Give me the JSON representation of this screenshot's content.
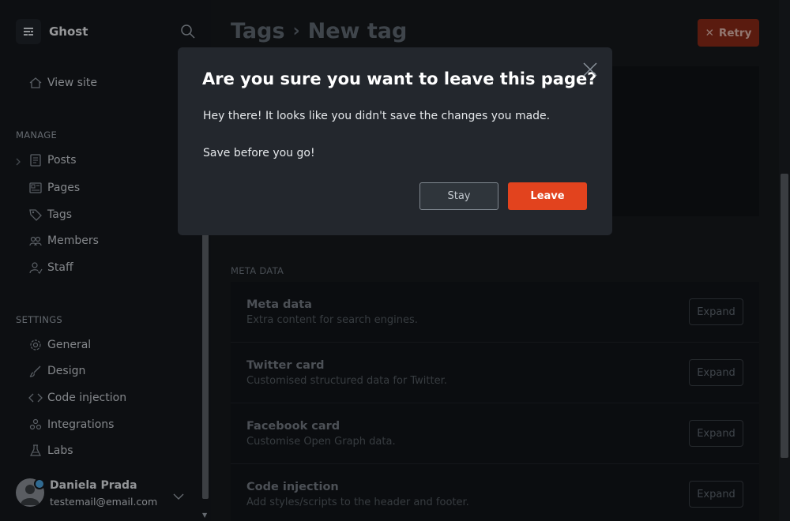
{
  "sidebar": {
    "brand": "Ghost",
    "view_site": "View site",
    "manage_heading": "MANAGE",
    "manage": [
      "Posts",
      "Pages",
      "Tags",
      "Members",
      "Staff"
    ],
    "settings_heading": "SETTINGS",
    "settings": [
      "General",
      "Design",
      "Code injection",
      "Integrations",
      "Labs"
    ],
    "user": {
      "name": "Daniela Prada",
      "email": "testemail@email.com"
    }
  },
  "header": {
    "breadcrumb_parent": "Tags",
    "breadcrumb_separator": "›",
    "breadcrumb_current": "New tag",
    "retry_label": "Retry"
  },
  "meta": {
    "heading": "META DATA",
    "expand_label": "Expand",
    "rows": [
      {
        "title": "Meta data",
        "desc": "Extra content for search engines."
      },
      {
        "title": "Twitter card",
        "desc": "Customised structured data for Twitter."
      },
      {
        "title": "Facebook card",
        "desc": "Customise Open Graph data."
      },
      {
        "title": "Code injection",
        "desc": "Add styles/scripts to the header and footer."
      }
    ]
  },
  "modal": {
    "title": "Are you sure you want to leave this page?",
    "line1": "Hey there! It looks like you didn't save the changes you made.",
    "line2": "Save before you go!",
    "stay_label": "Stay",
    "leave_label": "Leave"
  },
  "colors": {
    "accent_red": "#e2431e",
    "retry_red": "#8b2a18",
    "modal_bg": "#23272d"
  }
}
